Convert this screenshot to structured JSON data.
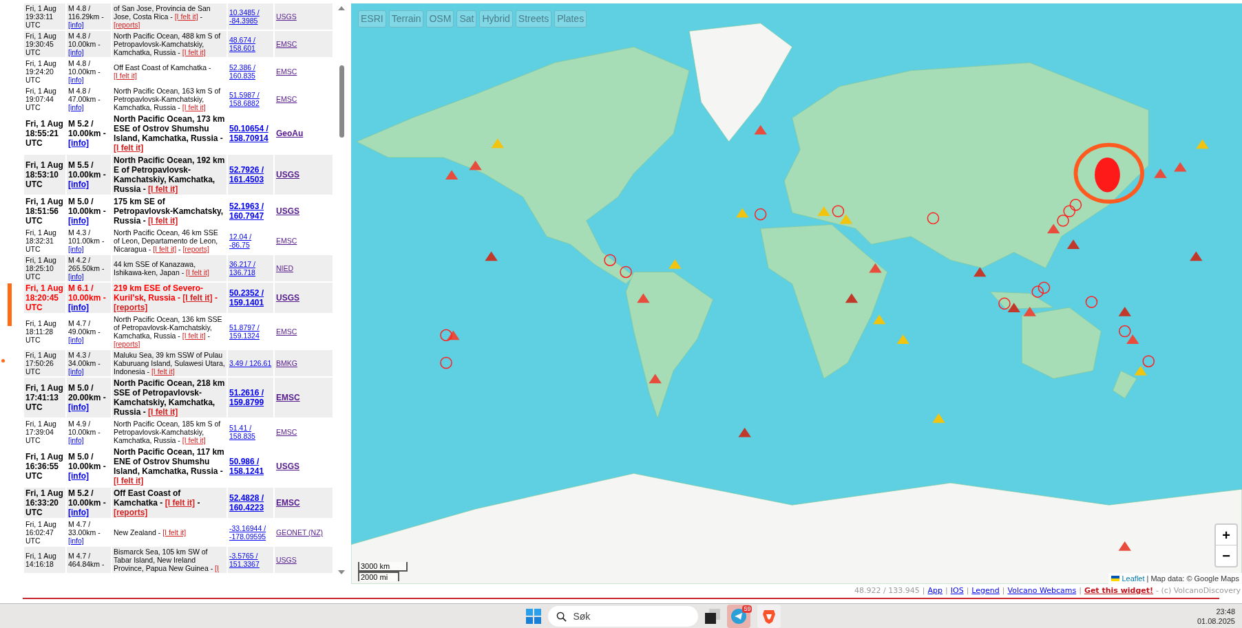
{
  "quakes": [
    {
      "kind": "minor",
      "shaded": true,
      "time": "Fri, 1 Aug 19:33:11 UTC",
      "mag": "M 4.8 / 116.29km -",
      "info": "[info]",
      "place": "of San Jose, Provincia de San Jose, Costa Rica -",
      "felt": "[I felt it]",
      "felt_sep": "-",
      "reports": "[reports]",
      "coords": "10.3485 / -84.3985",
      "source": "USGS"
    },
    {
      "kind": "minor",
      "shaded": true,
      "time": "Fri, 1 Aug 19:30:45 UTC",
      "mag": "M 4.8 / 10.00km -",
      "info": "[info]",
      "place": "North Pacific Ocean, 488 km S of Petropavlovsk-Kamchatskiy, Kamchatka, Russia -",
      "felt": "[I felt it]",
      "coords": "48.674 / 158.601",
      "source": "EMSC"
    },
    {
      "kind": "minor",
      "shaded": false,
      "time": "Fri, 1 Aug 19:24:20 UTC",
      "mag": "M 4.8 / 10.00km -",
      "info": "[info]",
      "place": "Off East Coast of Kamchatka -",
      "felt": "[I felt it]",
      "coords": "52.386 / 160.835",
      "source": "EMSC"
    },
    {
      "kind": "minor",
      "shaded": false,
      "time": "Fri, 1 Aug 19:07:44 UTC",
      "mag": "M 4.8 / 47.00km -",
      "info": "[info]",
      "place": "North Pacific Ocean, 163 km S of Petropavlovsk-Kamchatskiy, Kamchatka, Russia -",
      "felt": "[I felt it]",
      "coords": "51.5987 / 158.6882",
      "source": "EMSC"
    },
    {
      "kind": "major",
      "shaded": false,
      "time": "Fri, 1 Aug 18:55:21 UTC",
      "mag": "M 5.2 / 10.00km -",
      "info": "[info]",
      "place": "North Pacific Ocean, 173 km ESE of Ostrov Shumshu Island, Kamchatka, Russia -",
      "felt": "[I felt it]",
      "coords": "50.10654 / 158.70914",
      "source": "GeoAu"
    },
    {
      "kind": "major",
      "shaded": true,
      "time": "Fri, 1 Aug 18:53:10 UTC",
      "mag": "M 5.5 / 10.00km -",
      "info": "[info]",
      "place": "North Pacific Ocean, 192 km E of Petropavlovsk-Kamchatskiy, Kamchatka, Russia -",
      "felt": "[I felt it]",
      "coords": "52.7926 / 161.4503",
      "source": "USGS"
    },
    {
      "kind": "major",
      "shaded": false,
      "time": "Fri, 1 Aug 18:51:56 UTC",
      "mag": "M 5.0 / 10.00km -",
      "info": "[info]",
      "place": "175 km SE of Petropavlovsk-Kamchatsky, Russia -",
      "felt": "[I felt it]",
      "coords": "52.1963 / 160.7947",
      "source": "USGS"
    },
    {
      "kind": "minor",
      "shaded": false,
      "time": "Fri, 1 Aug 18:32:31 UTC",
      "mag": "M 4.3 / 101.00km -",
      "info": "[info]",
      "place": "North Pacific Ocean, 46 km SSE of Leon, Departamento de Leon, Nicaragua -",
      "felt": "[I felt it]",
      "felt_sep": "-",
      "reports": "[reports]",
      "coords": "12.04 / -86.75",
      "source": "EMSC"
    },
    {
      "kind": "minor",
      "shaded": true,
      "time": "Fri, 1 Aug 18:25:10 UTC",
      "mag": "M 4.2 / 265.50km -",
      "info": "[info]",
      "place": "44 km SSE of Kanazawa, Ishikawa-ken, Japan -",
      "felt": "[I felt it]",
      "coords": "36.217 / 136.718",
      "source": "NIED"
    },
    {
      "kind": "alert",
      "shaded": true,
      "time": "Fri, 1 Aug 18:20:45 UTC",
      "mag": "M 6.1 / 10.00km -",
      "info": "[info]",
      "place": "219 km ESE of Severo-Kuril’sk, Russia -",
      "felt": "[I felt it]",
      "felt_sep": "-",
      "reports": "[reports]",
      "coords": "50.2352 / 159.1401",
      "source": "USGS"
    },
    {
      "kind": "minor",
      "shaded": false,
      "time": "Fri, 1 Aug 18:11:28 UTC",
      "mag": "M 4.7 / 49.00km -",
      "info": "[info]",
      "place": "North Pacific Ocean, 136 km SSE of Petropavlovsk-Kamchatskiy, Kamchatka, Russia -",
      "felt": "[I felt it]",
      "felt_sep": "-",
      "reports": "[reports]",
      "coords": "51.8797 / 159.1324",
      "source": "EMSC"
    },
    {
      "kind": "minor",
      "shaded": true,
      "time": "Fri, 1 Aug 17:50:26 UTC",
      "mag": "M 4.3 / 34.00km -",
      "info": "[info]",
      "place": "Maluku Sea, 39 km SSW of Pulau Kaburuang Island, Sulawesi Utara, Indonesia -",
      "felt": "[I felt it]",
      "coords": "3.49 / 126.61",
      "source": "BMKG"
    },
    {
      "kind": "major",
      "shaded": true,
      "time": "Fri, 1 Aug 17:41:13 UTC",
      "mag": "M 5.0 / 20.00km -",
      "info": "[info]",
      "place": "North Pacific Ocean, 218 km SSE of Petropavlovsk-Kamchatskiy, Kamchatka, Russia -",
      "felt": "[I felt it]",
      "coords": "51.2616 / 159.8799",
      "source": "EMSC"
    },
    {
      "kind": "minor",
      "shaded": false,
      "time": "Fri, 1 Aug 17:39:04 UTC",
      "mag": "M 4.9 / 10.00km -",
      "info": "[info]",
      "place": "North Pacific Ocean, 185 km S of Petropavlovsk-Kamchatskiy, Kamchatka, Russia -",
      "felt": "[I felt it]",
      "coords": "51.41 / 158.835",
      "source": "EMSC"
    },
    {
      "kind": "major",
      "shaded": false,
      "time": "Fri, 1 Aug 16:36:55 UTC",
      "mag": "M 5.0 / 10.00km -",
      "info": "[info]",
      "place": "North Pacific Ocean, 117 km ENE of Ostrov Shumshu Island, Kamchatka, Russia -",
      "felt": "[I felt it]",
      "coords": "50.986 / 158.1241",
      "source": "USGS"
    },
    {
      "kind": "major",
      "shaded": true,
      "time": "Fri, 1 Aug 16:33:20 UTC",
      "mag": "M 5.2 / 10.00km -",
      "info": "[info]",
      "place": "Off East Coast of Kamchatka -",
      "felt": "[I felt it]",
      "felt_sep": "-",
      "reports": "[reports]",
      "coords": "52.4828 / 160.4223",
      "source": "EMSC"
    },
    {
      "kind": "minor",
      "shaded": false,
      "time": "Fri, 1 Aug 16:02:47 UTC",
      "mag": "M 4.7 / 33.00km -",
      "info": "[info]",
      "place": "New Zealand -",
      "felt": "[I felt it]",
      "coords": "-33.16944 / -178.09595",
      "source": "GEONET (NZ)"
    },
    {
      "kind": "minor",
      "shaded": true,
      "time": "Fri, 1 Aug 14:16:18",
      "mag": "M 4.7 / 464.84km -",
      "place": "Bismarck Sea, 105 km SW of Tabar Island, New Ireland Province, Papua New Guinea -",
      "felt": "[I",
      "coords": "-3.5765 / 151.3367",
      "source": "USGS"
    }
  ],
  "map": {
    "layers": [
      "ESRI",
      "Terrain",
      "OSM",
      "Sat",
      "Hybrid",
      "Streets",
      "Plates"
    ],
    "zoom_in": "+",
    "zoom_out": "−",
    "scale": [
      "3000 km",
      "2000 mi"
    ],
    "attribution_link": "Leaflet",
    "attribution": "| Map data: © Google Maps"
  },
  "footer": [
    {
      "kind": "text",
      "text": "48.922 / 133.945"
    },
    {
      "kind": "sep",
      "text": "|"
    },
    {
      "kind": "link",
      "text": "App"
    },
    {
      "kind": "sep",
      "text": "|"
    },
    {
      "kind": "link",
      "text": "IOS"
    },
    {
      "kind": "sep",
      "text": "|"
    },
    {
      "kind": "link",
      "text": "Legend"
    },
    {
      "kind": "sep",
      "text": "|"
    },
    {
      "kind": "link",
      "text": "Volcano Webcams"
    },
    {
      "kind": "sep",
      "text": "|"
    },
    {
      "kind": "promo",
      "text": "Get this widget!"
    },
    {
      "kind": "text",
      "text": "- (c) VolcanoDiscovery"
    }
  ],
  "taskbar": {
    "search_placeholder": "Søk",
    "telegram_badge": "59",
    "telegram_selected": true,
    "time": "23:48",
    "date": "01.08.2025"
  }
}
